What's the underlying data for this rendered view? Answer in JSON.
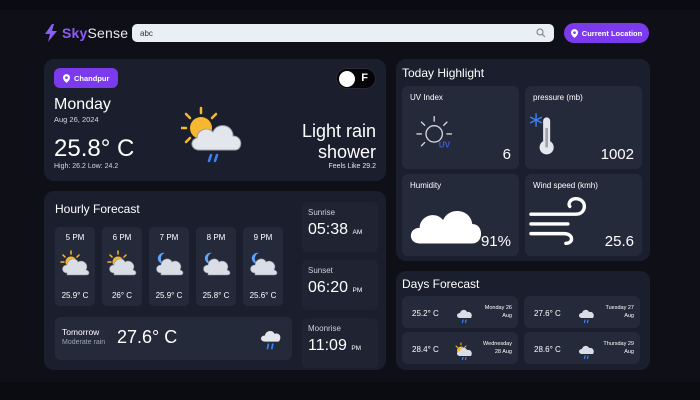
{
  "app": {
    "brand_part1": "Sky",
    "brand_part2": "Sense"
  },
  "search": {
    "value": "abc"
  },
  "header": {
    "location_button": "Current Location"
  },
  "current": {
    "city": "Chandpur",
    "toggle_label": "F",
    "day": "Monday",
    "date": "Aug 26, 2024",
    "temp": "25.8° C",
    "hilo": "High:  26.2  Low:  24.2",
    "condition": "Light rain shower",
    "feels_like": "Feels Like 29.2"
  },
  "hourly": {
    "title": "Hourly Forecast",
    "items": [
      {
        "time": "5 PM",
        "temp": "25.9° C",
        "icon": "sun-cloud-icon"
      },
      {
        "time": "6 PM",
        "temp": "26° C",
        "icon": "sun-cloud-icon"
      },
      {
        "time": "7 PM",
        "temp": "25.9° C",
        "icon": "moon-cloud-icon"
      },
      {
        "time": "8 PM",
        "temp": "25.8° C",
        "icon": "moon-cloud-icon"
      },
      {
        "time": "9 PM",
        "temp": "25.6° C",
        "icon": "moon-cloud-icon"
      }
    ],
    "tomorrow": {
      "label": "Tomorrow",
      "desc": "Moderate rain",
      "temp": "27.6° C"
    }
  },
  "sun": {
    "sunrise_label": "Sunrise",
    "sunrise_time": "05:38",
    "sunrise_ampm": "AM",
    "sunset_label": "Sunset",
    "sunset_time": "06:20",
    "sunset_ampm": "PM",
    "moonrise_label": "Moonrise",
    "moonrise_time": "11:09",
    "moonrise_ampm": "PM"
  },
  "highlights": {
    "title": "Today Highlight",
    "uv": {
      "label": "UV Index",
      "value": "6",
      "icon_text": "UV"
    },
    "pressure": {
      "label": "pressure (mb)",
      "value": "1002"
    },
    "humidity": {
      "label": "Humidity",
      "value": "91%"
    },
    "wind": {
      "label": "Wind speed (kmh)",
      "value": "25.6"
    }
  },
  "days": {
    "title": "Days Forecast",
    "items": [
      {
        "temp": "25.2° C",
        "day": "Monday 26",
        "month": "Aug",
        "icon": "rain-cloud-icon"
      },
      {
        "temp": "27.6° C",
        "day": "Tuesday 27",
        "month": "Aug",
        "icon": "rain-cloud-icon"
      },
      {
        "temp": "28.4° C",
        "day": "Wednesday",
        "month": "28 Aug",
        "icon": "sun-rain-cloud-icon"
      },
      {
        "temp": "28.6° C",
        "day": "Thursday 29",
        "month": "Aug",
        "icon": "rain-cloud-icon"
      }
    ]
  },
  "colors": {
    "accent": "#7c3aed",
    "background": "#0f1017",
    "card": "#1b1e2c",
    "inner": "#252a3b"
  }
}
